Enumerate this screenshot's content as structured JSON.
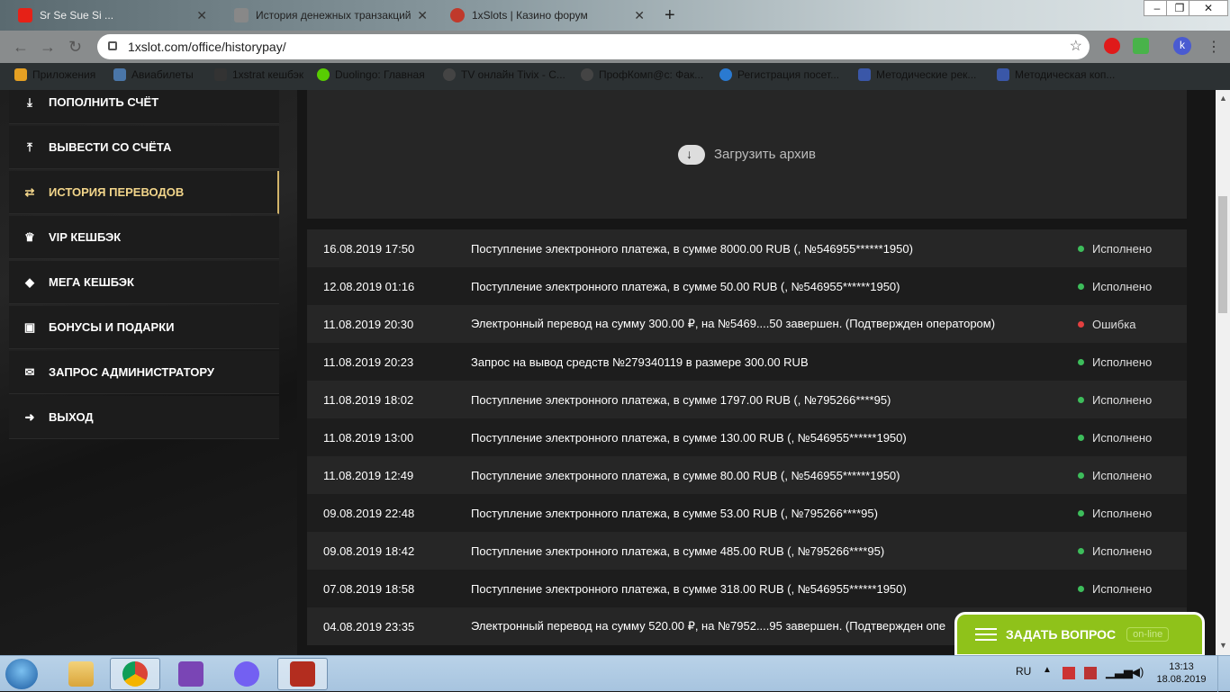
{
  "browser": {
    "tabs": [
      {
        "title": "Sr Se Sue Si ..."
      },
      {
        "title": "История денежных транзакций"
      },
      {
        "title": "1xSlots | Казино форум"
      }
    ],
    "url": "1xslot.com/office/historypay/",
    "profile_initial": "k",
    "bookmarks": [
      {
        "label": "Приложения"
      },
      {
        "label": "Авиабилеты"
      },
      {
        "label": "1xstrat кешбэк"
      },
      {
        "label": "Duolingo: Главная"
      },
      {
        "label": "TV онлайн Tivix - С..."
      },
      {
        "label": "ПрофКомп@с: Фак..."
      },
      {
        "label": "Регистрация посет..."
      },
      {
        "label": "Методические рек..."
      },
      {
        "label": "Методическая коп..."
      }
    ]
  },
  "sidebar": {
    "items": [
      {
        "label": "ПОПОЛНИТЬ СЧЁТ",
        "icon": "download-icon",
        "glyph": "⤓"
      },
      {
        "label": "ВЫВЕСТИ СО СЧЁТА",
        "icon": "upload-icon",
        "glyph": "⤒"
      },
      {
        "label": "ИСТОРИЯ ПЕРЕВОДОВ",
        "icon": "swap-icon",
        "glyph": "⇄"
      },
      {
        "label": "VIP КЕШБЭК",
        "icon": "crown-icon",
        "glyph": "♛"
      },
      {
        "label": "МЕГА КЕШБЭК",
        "icon": "diamond-icon",
        "glyph": "◆"
      },
      {
        "label": "БОНУСЫ И ПОДАРКИ",
        "icon": "gift-icon",
        "glyph": "▣"
      },
      {
        "label": "ЗАПРОС АДМИНИСТРАТОРУ",
        "icon": "mail-icon",
        "glyph": "✉"
      },
      {
        "label": "ВЫХОД",
        "icon": "logout-icon",
        "glyph": "➜"
      }
    ],
    "active_index": 2
  },
  "archive": {
    "label": "Загрузить архив"
  },
  "transactions": [
    {
      "date": "16.08.2019 17:50",
      "desc": "Поступление электронного платежа, в сумме 8000.00 RUB (, №546955******1950)",
      "status": "Исполнено",
      "ok": true
    },
    {
      "date": "12.08.2019 01:16",
      "desc": "Поступление электронного платежа, в сумме 50.00 RUB (, №546955******1950)",
      "status": "Исполнено",
      "ok": true
    },
    {
      "date": "11.08.2019 20:30",
      "desc": "Электронный перевод на сумму 300.00 ₽, на №5469....50 завершен. (Подтвержден оператором)",
      "status": "Ошибка",
      "ok": false
    },
    {
      "date": "11.08.2019 20:23",
      "desc": "Запрос на вывод средств №279340119 в размере 300.00 RUB",
      "status": "Исполнено",
      "ok": true
    },
    {
      "date": "11.08.2019 18:02",
      "desc": "Поступление электронного платежа, в сумме 1797.00 RUB (, №795266****95)",
      "status": "Исполнено",
      "ok": true
    },
    {
      "date": "11.08.2019 13:00",
      "desc": "Поступление электронного платежа, в сумме 130.00 RUB (, №546955******1950)",
      "status": "Исполнено",
      "ok": true
    },
    {
      "date": "11.08.2019 12:49",
      "desc": "Поступление электронного платежа, в сумме 80.00 RUB (, №546955******1950)",
      "status": "Исполнено",
      "ok": true
    },
    {
      "date": "09.08.2019 22:48",
      "desc": "Поступление электронного платежа, в сумме 53.00 RUB (, №795266****95)",
      "status": "Исполнено",
      "ok": true
    },
    {
      "date": "09.08.2019 18:42",
      "desc": "Поступление электронного платежа, в сумме 485.00 RUB (, №795266****95)",
      "status": "Исполнено",
      "ok": true
    },
    {
      "date": "07.08.2019 18:58",
      "desc": "Поступление электронного платежа, в сумме 318.00 RUB (, №546955******1950)",
      "status": "Исполнено",
      "ok": true
    },
    {
      "date": "04.08.2019 23:35",
      "desc": "Электронный перевод на сумму 520.00 ₽, на №7952....95 завершен. (Подтвержден опе",
      "status": "",
      "ok": true
    }
  ],
  "chat": {
    "label": "ЗАДАТЬ ВОПРОС",
    "status": "on-line"
  },
  "taskbar": {
    "lang": "RU",
    "time": "13:13",
    "date": "18.08.2019"
  },
  "colors": {
    "accent": "#f2d58a",
    "ok": "#3dbd5b",
    "error": "#e34040",
    "chat": "#8fc21a"
  }
}
